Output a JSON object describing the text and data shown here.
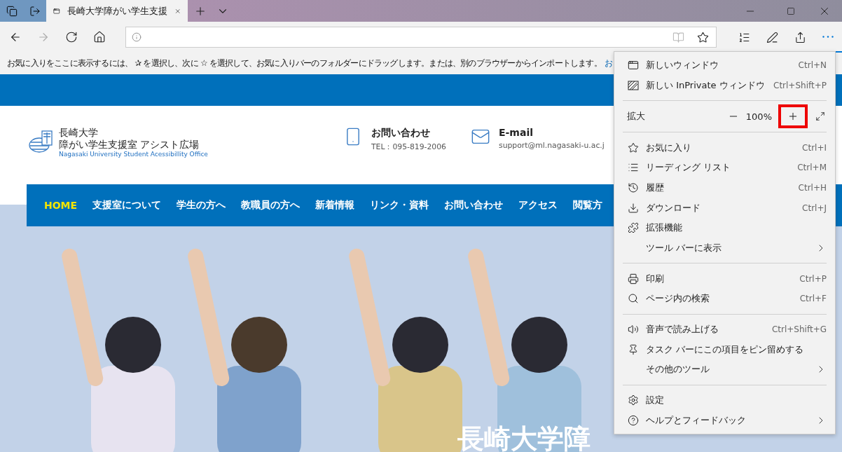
{
  "window": {
    "tabs": [
      {
        "title": "長崎大学障がい学生支援",
        "selected": true
      }
    ]
  },
  "toolbar": {
    "nav_buttons": [
      {
        "disabled": false
      },
      {
        "disabled": true
      },
      {
        "disabled": false
      },
      {
        "disabled": false
      }
    ],
    "more_selected": true
  },
  "favorites_bar": {
    "message": "お気に入りをここに表示するには、 ✰ を選択し、次に ☆ を選択して、お気に入りバーのフォルダーにドラッグします。または、別のブラウザーからインポートします。",
    "link": "お"
  },
  "site": {
    "logo": {
      "title": "長崎大学",
      "subtitle": "障がい学生支援室 アシスト広場",
      "english": "Nagasaki University Student Acessibillity Office"
    },
    "contacts": [
      {
        "title": "お問い合わせ",
        "detail": "TEL：095-819-2006"
      },
      {
        "title": "E-mail",
        "detail": "support@ml.nagasaki-u.ac.j"
      }
    ],
    "nav": [
      {
        "label": "HOME",
        "selected": true
      },
      {
        "label": "支援室について",
        "selected": false
      },
      {
        "label": "学生の方へ",
        "selected": false
      },
      {
        "label": "教職員の方へ",
        "selected": false
      },
      {
        "label": "新着情報",
        "selected": false
      },
      {
        "label": "リンク・資料",
        "selected": false
      },
      {
        "label": "お問い合わせ",
        "selected": false
      },
      {
        "label": "アクセス",
        "selected": false
      },
      {
        "label": "閲覧方",
        "selected": false
      }
    ],
    "hero": {
      "kind": "picture",
      "headline": "長崎大学障"
    }
  },
  "menu": {
    "items": [
      {
        "kind": "item",
        "label": "新しいウィンドウ",
        "shortcut": "Ctrl+N"
      },
      {
        "kind": "item",
        "label": "新しい InPrivate ウィンドウ",
        "shortcut": "Ctrl+Shift+P"
      },
      {
        "kind": "separator"
      },
      {
        "kind": "zoom",
        "label": "拡大",
        "value": "100%",
        "highlighted": true
      },
      {
        "kind": "separator"
      },
      {
        "kind": "item",
        "label": "お気に入り",
        "shortcut": "Ctrl+I"
      },
      {
        "kind": "item",
        "label": "リーディング リスト",
        "shortcut": "Ctrl+M"
      },
      {
        "kind": "item",
        "label": "履歴",
        "shortcut": "Ctrl+H"
      },
      {
        "kind": "item",
        "label": "ダウンロード",
        "shortcut": "Ctrl+J"
      },
      {
        "kind": "item",
        "label": "拡張機能"
      },
      {
        "kind": "submenu",
        "label": "ツール バーに表示"
      },
      {
        "kind": "separator"
      },
      {
        "kind": "item",
        "label": "印刷",
        "shortcut": "Ctrl+P"
      },
      {
        "kind": "item",
        "label": "ページ内の検索",
        "shortcut": "Ctrl+F"
      },
      {
        "kind": "separator"
      },
      {
        "kind": "item",
        "label": "音声で読み上げる",
        "shortcut": "Ctrl+Shift+G"
      },
      {
        "kind": "item",
        "label": "タスク バーにこの項目をピン留めする"
      },
      {
        "kind": "submenu",
        "label": "その他のツール"
      },
      {
        "kind": "separator"
      },
      {
        "kind": "item",
        "label": "設定"
      },
      {
        "kind": "submenu",
        "label": "ヘルプとフィードバック"
      }
    ]
  }
}
